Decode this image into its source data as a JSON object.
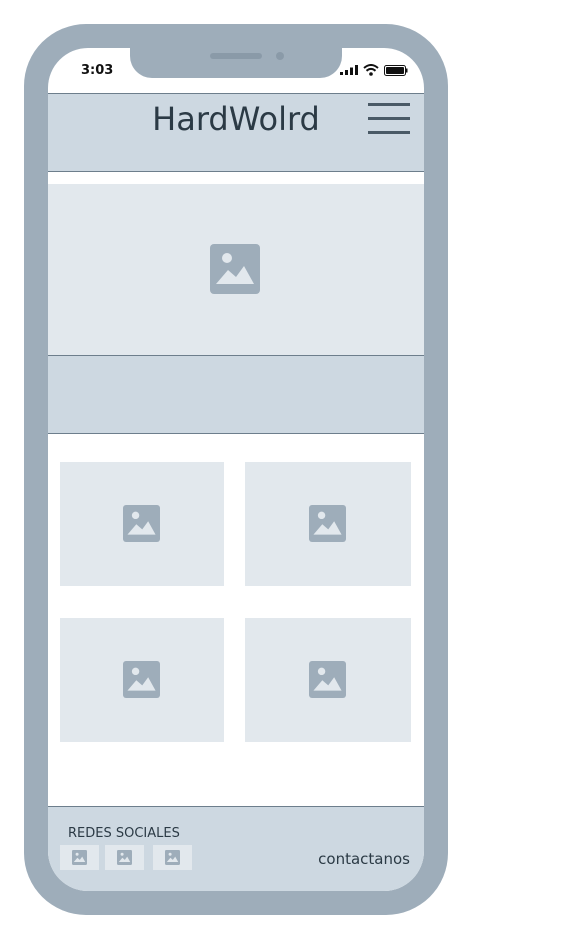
{
  "status_bar": {
    "time": "3:03",
    "icons": [
      "signal-icon",
      "wifi-icon",
      "battery-icon"
    ]
  },
  "header": {
    "title": "HardWolrd",
    "menu_icon": "hamburger-menu-icon"
  },
  "hero": {
    "icon": "image-placeholder-icon"
  },
  "grid": {
    "icon": "image-placeholder-icon",
    "tile_count": 4
  },
  "footer": {
    "social_label": "REDES SOCIALES",
    "social_icons": [
      "image-placeholder-icon",
      "image-placeholder-icon",
      "image-placeholder-icon"
    ],
    "contact_label": "contactanos"
  },
  "colors": {
    "frame": "#9eadba",
    "panel": "#cdd8e1",
    "placeholder": "#e2e8ed",
    "border": "#6d7e8c",
    "text": "#2b3a45"
  }
}
